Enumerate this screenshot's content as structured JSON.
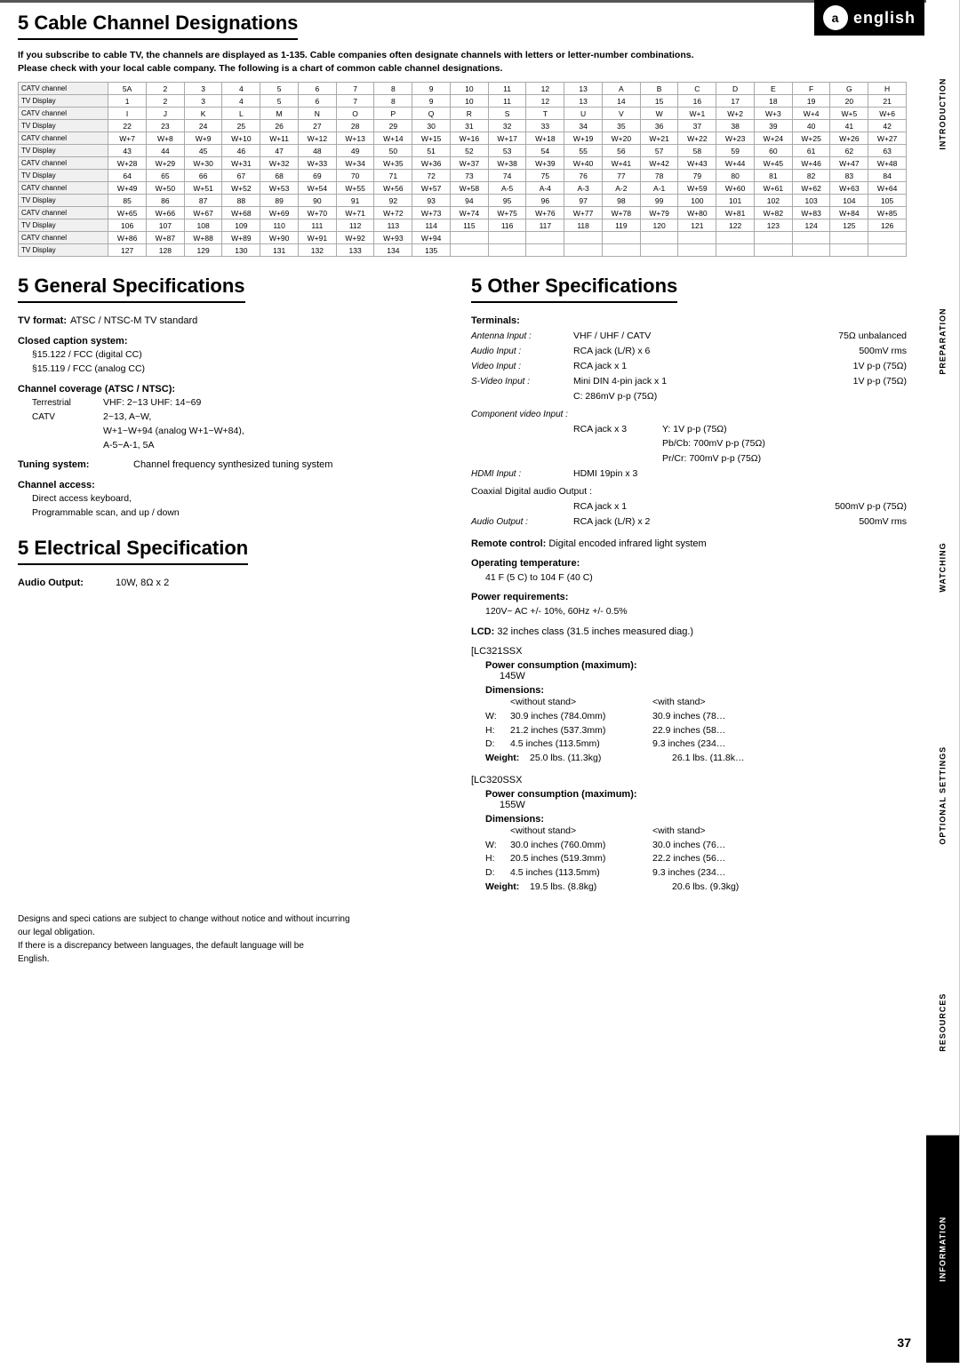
{
  "logo": {
    "icon_label": "a",
    "text": "english"
  },
  "side_tabs": [
    {
      "label": "INTRODUCTION",
      "active": false
    },
    {
      "label": "PREPARATION",
      "active": false
    },
    {
      "label": "WATCHING",
      "active": false
    },
    {
      "label": "OPTIONAL SETTINGS",
      "active": false
    },
    {
      "label": "RESOURCES",
      "active": false
    },
    {
      "label": "INFORMATION",
      "active": true
    }
  ],
  "cable_section": {
    "title": "5 Cable Channel Designations",
    "intro": "If you subscribe to cable TV, the channels are displayed as 1-135. Cable companies often designate channels with letters or letter-number combinations.\nPlease check with your local cable company. The following is a chart of common cable channel designations.",
    "table_rows": [
      {
        "type": "CATV channel",
        "cols": [
          "5A",
          "2",
          "3",
          "4",
          "5",
          "6",
          "7",
          "8",
          "9",
          "10",
          "11",
          "12",
          "13",
          "A",
          "B",
          "C",
          "D",
          "E",
          "F",
          "G",
          "H"
        ]
      },
      {
        "type": "TV Display",
        "cols": [
          "1",
          "2",
          "3",
          "4",
          "5",
          "6",
          "7",
          "8",
          "9",
          "10",
          "11",
          "12",
          "13",
          "14",
          "15",
          "16",
          "17",
          "18",
          "19",
          "20",
          "21"
        ]
      },
      {
        "type": "CATV channel",
        "cols": [
          "I",
          "J",
          "K",
          "L",
          "M",
          "N",
          "O",
          "P",
          "Q",
          "R",
          "S",
          "T",
          "U",
          "V",
          "W",
          "W+1",
          "W+2",
          "W+3",
          "W+4",
          "W+5",
          "W+6"
        ]
      },
      {
        "type": "TV Display",
        "cols": [
          "22",
          "23",
          "24",
          "25",
          "26",
          "27",
          "28",
          "29",
          "30",
          "31",
          "32",
          "33",
          "34",
          "35",
          "36",
          "37",
          "38",
          "39",
          "40",
          "41",
          "42"
        ]
      },
      {
        "type": "CATV channel",
        "cols": [
          "W+7",
          "W+8",
          "W+9",
          "W+10",
          "W+11",
          "W+12",
          "W+13",
          "W+14",
          "W+15",
          "W+16",
          "W+17",
          "W+18",
          "W+19",
          "W+20",
          "W+21",
          "W+22",
          "W+23",
          "W+24",
          "W+25",
          "W+26",
          "W+27"
        ]
      },
      {
        "type": "TV Display",
        "cols": [
          "43",
          "44",
          "45",
          "46",
          "47",
          "48",
          "49",
          "50",
          "51",
          "52",
          "53",
          "54",
          "55",
          "56",
          "57",
          "58",
          "59",
          "60",
          "61",
          "62",
          "63"
        ]
      },
      {
        "type": "CATV channel",
        "cols": [
          "W+28",
          "W+29",
          "W+30",
          "W+31",
          "W+32",
          "W+33",
          "W+34",
          "W+35",
          "W+36",
          "W+37",
          "W+38",
          "W+39",
          "W+40",
          "W+41",
          "W+42",
          "W+43",
          "W+44",
          "W+45",
          "W+46",
          "W+47",
          "W+48"
        ]
      },
      {
        "type": "TV Display",
        "cols": [
          "64",
          "65",
          "66",
          "67",
          "68",
          "69",
          "70",
          "71",
          "72",
          "73",
          "74",
          "75",
          "76",
          "77",
          "78",
          "79",
          "80",
          "81",
          "82",
          "83",
          "84"
        ]
      },
      {
        "type": "CATV channel",
        "cols": [
          "W+49",
          "W+50",
          "W+51",
          "W+52",
          "W+53",
          "W+54",
          "W+55",
          "W+56",
          "W+57",
          "W+58",
          "A-5",
          "A-4",
          "A-3",
          "A-2",
          "A-1",
          "W+59",
          "W+60",
          "W+61",
          "W+62",
          "W+63",
          "W+64"
        ]
      },
      {
        "type": "TV Display",
        "cols": [
          "85",
          "86",
          "87",
          "88",
          "89",
          "90",
          "91",
          "92",
          "93",
          "94",
          "95",
          "96",
          "97",
          "98",
          "99",
          "100",
          "101",
          "102",
          "103",
          "104",
          "105"
        ]
      },
      {
        "type": "CATV channel",
        "cols": [
          "W+65",
          "W+66",
          "W+67",
          "W+68",
          "W+69",
          "W+70",
          "W+71",
          "W+72",
          "W+73",
          "W+74",
          "W+75",
          "W+76",
          "W+77",
          "W+78",
          "W+79",
          "W+80",
          "W+81",
          "W+82",
          "W+83",
          "W+84",
          "W+85"
        ]
      },
      {
        "type": "TV Display",
        "cols": [
          "106",
          "107",
          "108",
          "109",
          "110",
          "111",
          "112",
          "113",
          "114",
          "115",
          "116",
          "117",
          "118",
          "119",
          "120",
          "121",
          "122",
          "123",
          "124",
          "125",
          "126"
        ]
      },
      {
        "type": "CATV channel",
        "cols": [
          "W+86",
          "W+87",
          "W+88",
          "W+89",
          "W+90",
          "W+91",
          "W+92",
          "W+93",
          "W+94",
          "",
          "",
          "",
          "",
          "",
          "",
          "",
          "",
          "",
          "",
          "",
          ""
        ]
      },
      {
        "type": "TV Display",
        "cols": [
          "127",
          "128",
          "129",
          "130",
          "131",
          "132",
          "133",
          "134",
          "135",
          "",
          "",
          "",
          "",
          "",
          "",
          "",
          "",
          "",
          "",
          "",
          ""
        ]
      }
    ]
  },
  "general_specs": {
    "title": "5 General Specifications",
    "tv_format_label": "TV format:",
    "tv_format_value": "ATSC / NTSC-M TV standard",
    "closed_caption_label": "Closed caption system:",
    "closed_caption_lines": [
      "§15.122 / FCC (digital CC)",
      "§15.119 / FCC (analog CC)"
    ],
    "channel_coverage_label": "Channel coverage (ATSC / NTSC):",
    "terrestrial_label": "Terrestrial",
    "terrestrial_value": "VHF: 2~13  UHF: 14~69",
    "catv_label": "CATV",
    "catv_lines": [
      "2~13, A~W,",
      "W+1~W+94 (analog W+1~W+84),",
      "A-5~A-1, 5A"
    ],
    "tuning_label": "Tuning system:",
    "tuning_value": "Channel frequency synthesized tuning system",
    "channel_access_label": "Channel access:",
    "channel_access_lines": [
      "Direct access keyboard,",
      "Programmable scan, and up / down"
    ]
  },
  "electrical_spec": {
    "title": "5 Electrical Specification",
    "audio_output_label": "Audio Output:",
    "audio_output_value": "10W, 8Ω x 2"
  },
  "other_specs": {
    "title": "5 Other Specifications",
    "terminals_label": "Terminals:",
    "antenna_label": "Antenna Input :",
    "antenna_value": "VHF / UHF / CATV",
    "antenna_right": "75Ω unbalanced",
    "audio_input_label": "Audio Input :",
    "audio_input_value": "RCA jack (L/R) x 6",
    "audio_input_right": "500mV rms",
    "video_input_label": "Video Input :",
    "video_input_value": "RCA jack x 1",
    "video_input_right": "1V p-p (75Ω)",
    "svideo_label": "S-Video Input :",
    "svideo_value": "Mini DIN 4-pin jack x 1",
    "svideo_right": "1V p-p (75Ω)",
    "svideo_sub": "C: 286mV p-p (75Ω)",
    "component_label": "Component video Input :",
    "component_y": "Y:  1V p-p (75Ω)",
    "component_pb": "Pb/Cb: 700mV p-p (75Ω)",
    "component_pr": "Pr/Cr:  700mV p-p (75Ω)",
    "component_value": "RCA jack x 3",
    "hdmi_label": "HDMI Input :",
    "hdmi_value": "HDMI 19pin x 3",
    "coaxial_label": "Coaxial Digital audio Output :",
    "coaxial_value": "RCA jack x 1",
    "coaxial_right": "500mV p-p (75Ω)",
    "audio_out_label": "Audio Output :",
    "audio_out_value": "RCA jack (L/R) x 2",
    "audio_out_right": "500mV rms",
    "remote_label": "Remote control:",
    "remote_value": "Digital encoded infrared light system",
    "operating_temp_label": "Operating temperature:",
    "operating_temp_value": "41 F (5 C) to 104 F (40 C)",
    "power_req_label": "Power requirements:",
    "power_req_value": "120V~ AC +/- 10%, 60Hz +/- 0.5%",
    "lcd_label": "LCD:",
    "lcd_value": "32 inches class  (31.5 inches measured diag.)",
    "lc321ssx_label": "[LC321SSX",
    "lc321_power_label": "Power consumption (maximum):",
    "lc321_power_value": "145W",
    "lc321_dims_label": "Dimensions:",
    "lc321_dims_without": "<without stand>",
    "lc321_dims_with": "<with stand>",
    "lc321_w_label": "W:",
    "lc321_w_without": "30.9 inches  (784.0mm)",
    "lc321_w_with": "30.9 inches  (78…",
    "lc321_h_label": "H:",
    "lc321_h_without": "21.2 inches  (537.3mm)",
    "lc321_h_with": "22.9 inches  (58…",
    "lc321_d_label": "D:",
    "lc321_d_without": "4.5 inches   (113.5mm)",
    "lc321_d_with": "9.3 inches  (234…",
    "lc321_weight_label": "Weight:",
    "lc321_weight_without": "25.0 lbs.    (11.3kg)",
    "lc321_weight_with": "26.1 lbs.    (11.8k…",
    "lc320ssx_label": "[LC320SSX",
    "lc320_power_label": "Power consumption (maximum):",
    "lc320_power_value": "155W",
    "lc320_dims_label": "Dimensions:",
    "lc320_dims_without": "<without stand>",
    "lc320_dims_with": "<with stand>",
    "lc320_w_label": "W:",
    "lc320_w_without": "30.0 inches  (760.0mm)",
    "lc320_w_with": "30.0 inches  (76…",
    "lc320_h_label": "H:",
    "lc320_h_without": "20.5 inches  (519.3mm)",
    "lc320_h_with": "22.2 inches  (56…",
    "lc320_d_label": "D:",
    "lc320_d_without": "4.5 inches   (113.5mm)",
    "lc320_d_with": "9.3 inches  (234…",
    "lc320_weight_label": "Weight:",
    "lc320_weight_without": "19.5 lbs.    (8.8kg)",
    "lc320_weight_with": "20.6 lbs.    (9.3kg)"
  },
  "disclaimer": {
    "line1": "Designs and speci cations are subject to change without notice and without incurring",
    "line2": "our legal obligation.",
    "line3": "If there is a discrepancy between languages, the default language will be",
    "line4": "English."
  },
  "page_number": "37"
}
